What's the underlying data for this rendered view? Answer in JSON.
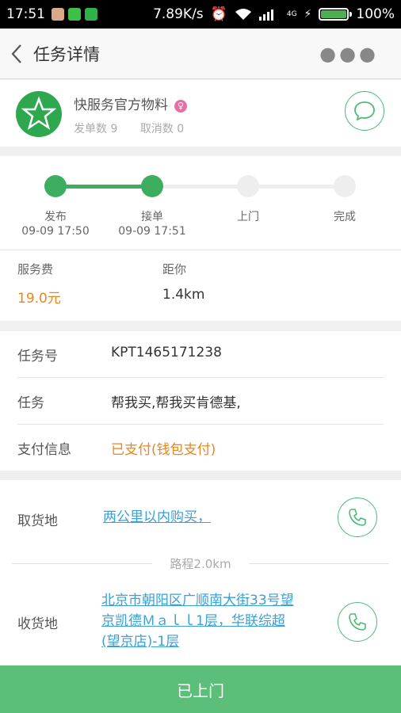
{
  "status_bar": {
    "time": "17:51",
    "speed": "7.89K/s",
    "network": "4G",
    "battery_level": 1.0,
    "battery_text": "100%"
  },
  "header": {
    "title": "任务详情",
    "back_icon": "chevron-left-icon",
    "more_icon": "more-icon"
  },
  "merchant": {
    "name": "快服务官方物料",
    "sent_orders": "发单数 9",
    "cancelled_orders": "取消数 0",
    "gender_icon": "female-icon",
    "chat_icon": "chat-icon"
  },
  "progress": {
    "current_step": 2,
    "steps": [
      {
        "label": "发布",
        "time": "09-09 17:50"
      },
      {
        "label": "接单",
        "time": "09-09 17:51"
      },
      {
        "label": "上门",
        "time": ""
      },
      {
        "label": "完成",
        "time": ""
      }
    ]
  },
  "fees": {
    "service_fee_label": "服务费",
    "service_fee_value": "19.0元",
    "distance_label": "距你",
    "distance_value": "1.4km"
  },
  "task_info": {
    "task_no_label": "任务号",
    "task_no_value": "KPT1465171238",
    "task_label": "任务",
    "task_value": "帮我买,帮我买肯德基,",
    "payment_label": "支付信息",
    "payment_value": "已支付(钱包支付)"
  },
  "address": {
    "pickup_label": "取货地",
    "pickup_value": "两公里以内购买，",
    "route_text": "路程2.0km",
    "delivery_label": "收货地",
    "delivery_lines": [
      "北京市朝阳区广顺南大街33号望",
      "京凯德Ｍａｌｌ1层，华联综超",
      "(望京店)-1层"
    ],
    "phone_icon": "phone-icon"
  },
  "action": {
    "label": "已上门"
  },
  "colors": {
    "accent_green": "#5bbf7a",
    "progress_green": "#3dae5f",
    "fee_orange": "#e8851d",
    "link_blue": "#3aa0d5"
  }
}
